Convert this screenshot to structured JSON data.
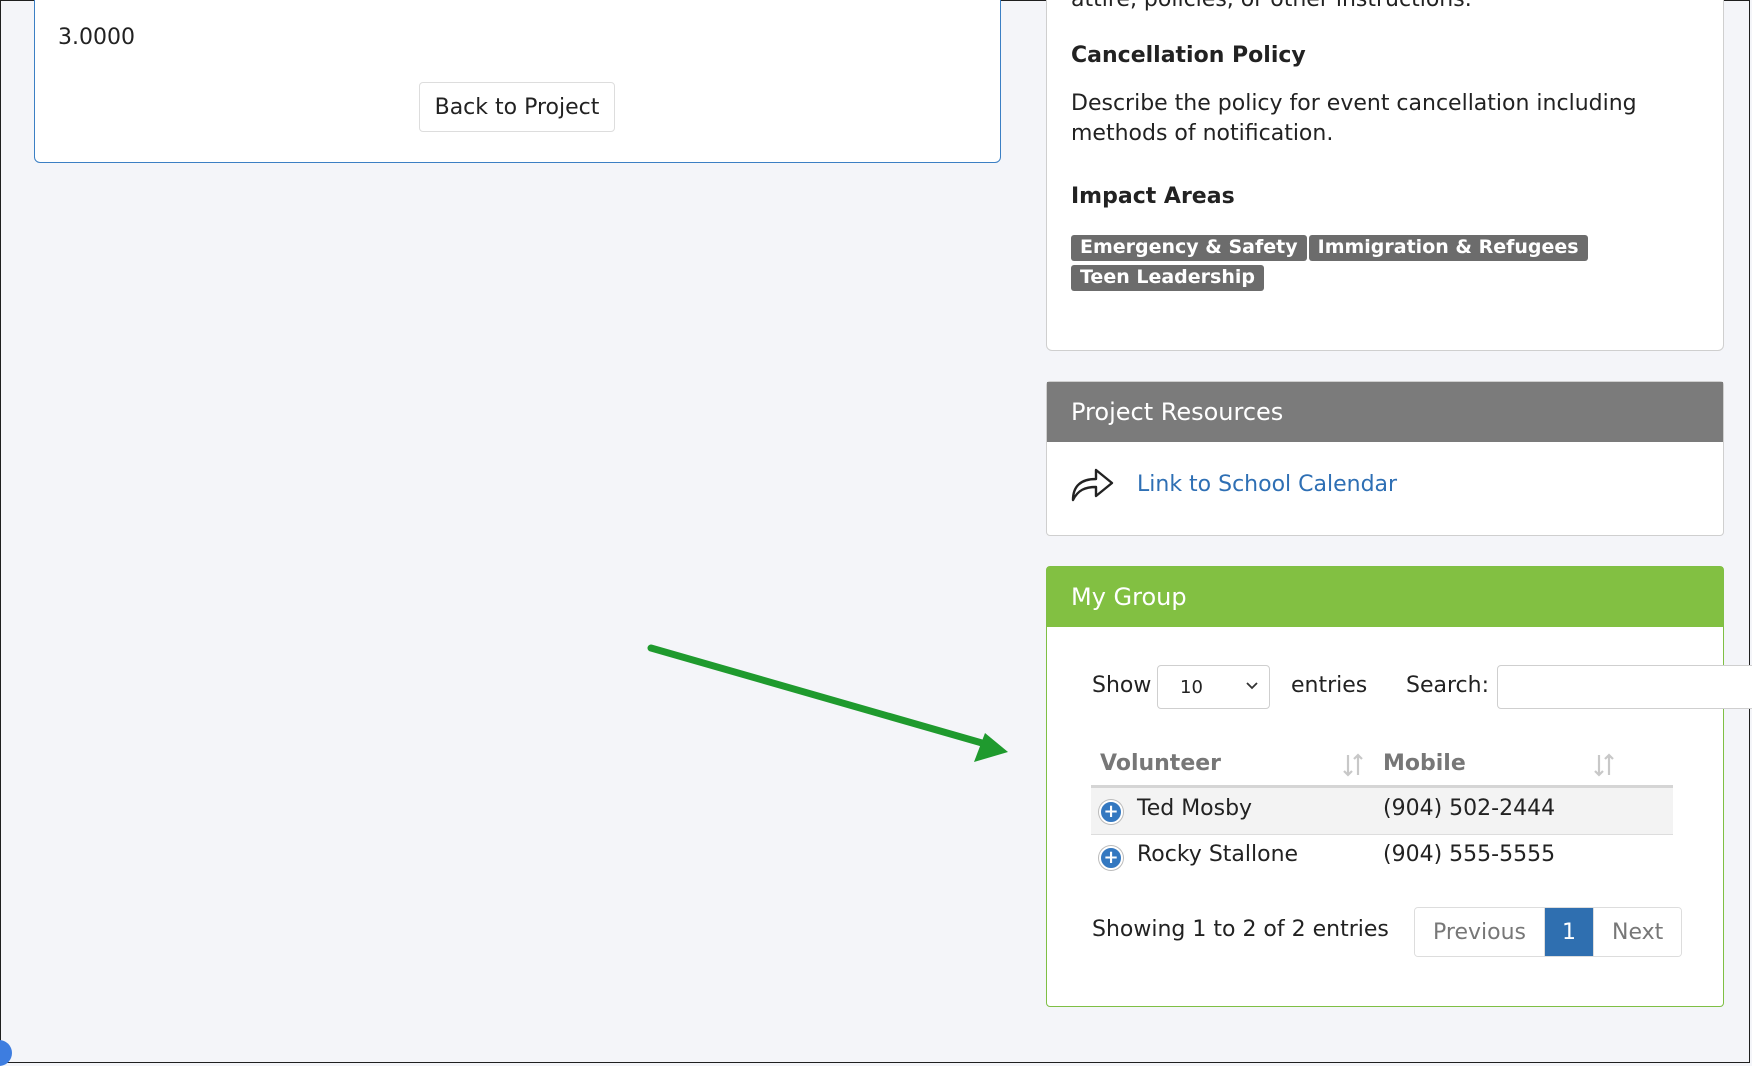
{
  "left_card": {
    "value": "3.0000",
    "back_label": "Back to Project"
  },
  "info_card": {
    "cut_text": "attire, policies, or other instructions.",
    "cancellation_title": "Cancellation Policy",
    "cancellation_desc": "Describe the policy for event cancellation including methods of notification.",
    "impact_title": "Impact Areas",
    "impact_tags": [
      "Emergency & Safety",
      "Immigration & Refugees",
      "Teen Leadership"
    ]
  },
  "resources": {
    "title": "Project Resources",
    "link_label": "Link to School Calendar",
    "icon": "share-icon"
  },
  "group": {
    "title": "My Group",
    "show_label": "Show",
    "entries_value": "10",
    "entries_label": "entries",
    "search_label": "Search:",
    "search_value": "",
    "columns": [
      "Volunteer",
      "Mobile"
    ],
    "rows": [
      {
        "volunteer": "Ted Mosby",
        "mobile": "(904) 502-2444"
      },
      {
        "volunteer": "Rocky Stallone",
        "mobile": "(904) 555-5555"
      }
    ],
    "info": "Showing 1 to 2 of 2 entries",
    "pager": {
      "previous": "Previous",
      "page": "1",
      "next": "Next"
    }
  },
  "colors": {
    "group_header": "#82c042",
    "resources_header": "#7b7b7b",
    "annotation_arrow": "#1f9a2e",
    "link": "#2e6fb4"
  }
}
